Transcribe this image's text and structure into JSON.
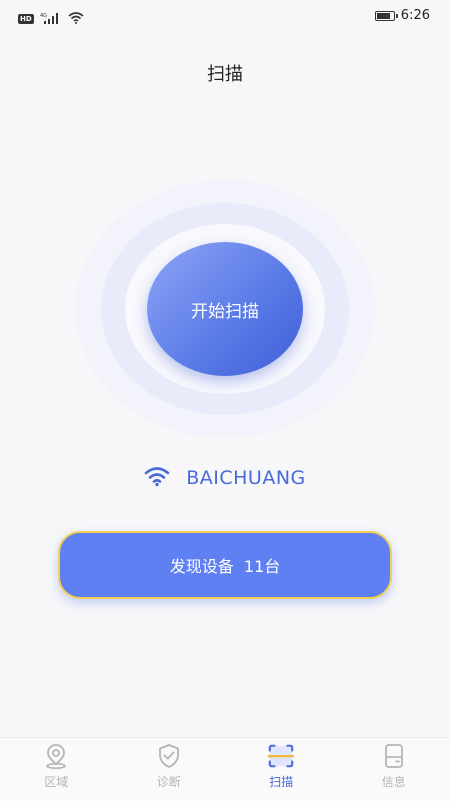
{
  "status_bar": {
    "hd_label": "HD",
    "network_label": "4G",
    "time": "6:26",
    "battery_level": 0.85
  },
  "page": {
    "title": "扫描"
  },
  "scan": {
    "button_label": "开始扫描"
  },
  "wifi": {
    "icon": "wifi-icon",
    "ssid": "BAICHUANG"
  },
  "devices": {
    "found_label": "发现设备  11台"
  },
  "tabs": [
    {
      "label": "区域",
      "icon": "location-pin-icon",
      "active": false
    },
    {
      "label": "诊断",
      "icon": "shield-check-icon",
      "active": false
    },
    {
      "label": "扫描",
      "icon": "scan-icon",
      "active": true
    },
    {
      "label": "信息",
      "icon": "device-info-icon",
      "active": false
    }
  ],
  "colors": {
    "accent": "#4a6ad8",
    "button_fill": "#5f80f2",
    "button_border": "#f2cf55",
    "inactive_tab": "#b5b5b5"
  }
}
